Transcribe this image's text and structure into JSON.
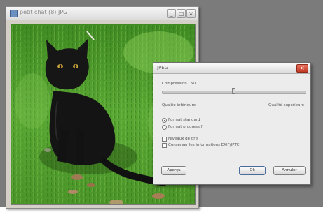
{
  "image_window": {
    "title": "petit chat (8) JPG",
    "controls": {
      "minimize": "_",
      "maximize": "□",
      "close": "×"
    },
    "subject_icon": "black-cat-on-grass"
  },
  "jpeg_dialog": {
    "title": "JPEG",
    "close_glyph": "×",
    "compression_label": "Compression : 50",
    "compression_value": 50,
    "quality_low_label": "Qualité inférieure",
    "quality_high_label": "Qualité supérieure",
    "format_options": [
      {
        "label": "Format standard",
        "selected": true
      },
      {
        "label": "Format progressif",
        "selected": false
      }
    ],
    "checkboxes": [
      {
        "label": "Niveaux de gris",
        "checked": false
      },
      {
        "label": "Conserver les informations EXIF/IPTC",
        "checked": false
      }
    ],
    "buttons": {
      "preview": "Aperçu",
      "ok": "Ok",
      "cancel": "Annuler"
    }
  },
  "colors": {
    "desktop": "#7b7b7b",
    "window_chrome": "#d4d0c8",
    "dialog_bg": "#ececec",
    "close_red": "#c13a25",
    "grass": "#4f9a2c"
  }
}
